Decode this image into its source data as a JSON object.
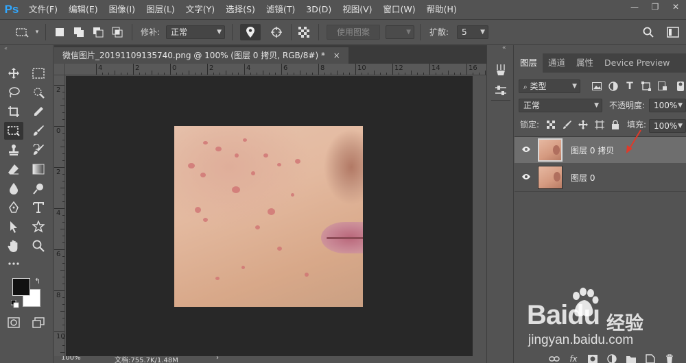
{
  "app": {
    "logo": "Ps"
  },
  "menu": [
    "文件(F)",
    "编辑(E)",
    "图像(I)",
    "图层(L)",
    "文字(Y)",
    "选择(S)",
    "滤镜(T)",
    "3D(D)",
    "视图(V)",
    "窗口(W)",
    "帮助(H)"
  ],
  "window_controls": {
    "minimize": "—",
    "restore": "❐",
    "close": "✕"
  },
  "options": {
    "patch_label": "修补:",
    "patch_mode": "正常",
    "use_pattern": "使用图案",
    "spread_label": "扩散:",
    "spread_value": "5"
  },
  "collapse": {
    "left": "«",
    "right": "«"
  },
  "document": {
    "tab_title": "微信图片_20191109135740.png @ 100% (图层 0 拷贝, RGB/8#) *",
    "close": "×",
    "ruler_top": [
      "4",
      "2",
      "0",
      "2",
      "4",
      "6",
      "8",
      "10",
      "12",
      "14",
      "16"
    ],
    "ruler_left": [
      "2",
      "0",
      "2",
      "4",
      "6",
      "8",
      "10"
    ],
    "zoom": "100%",
    "doc_info": "文档:755.7K/1.48M",
    "status_arrow": "›"
  },
  "panel": {
    "tabs": [
      "图层",
      "通道",
      "属性",
      "Device Preview"
    ],
    "active_tab": "图层",
    "filter_kind": "类型",
    "blend_mode": "正常",
    "opacity_label": "不透明度:",
    "opacity_value": "100%",
    "lock_label": "锁定:",
    "fill_label": "填充:",
    "fill_value": "100%",
    "layers": [
      {
        "name": "图层 0 拷贝",
        "selected": true
      },
      {
        "name": "图层 0",
        "selected": false
      }
    ],
    "bottom_fx": "fx"
  },
  "watermark": {
    "brand": "Baidu",
    "jingyan": "经验",
    "url": "jingyan.baidu.com"
  },
  "colors": {
    "accent": "#31a8ff",
    "annotation": "#e03a2a",
    "foreground_swatch": "#111111",
    "background_swatch": "#ffffff"
  }
}
